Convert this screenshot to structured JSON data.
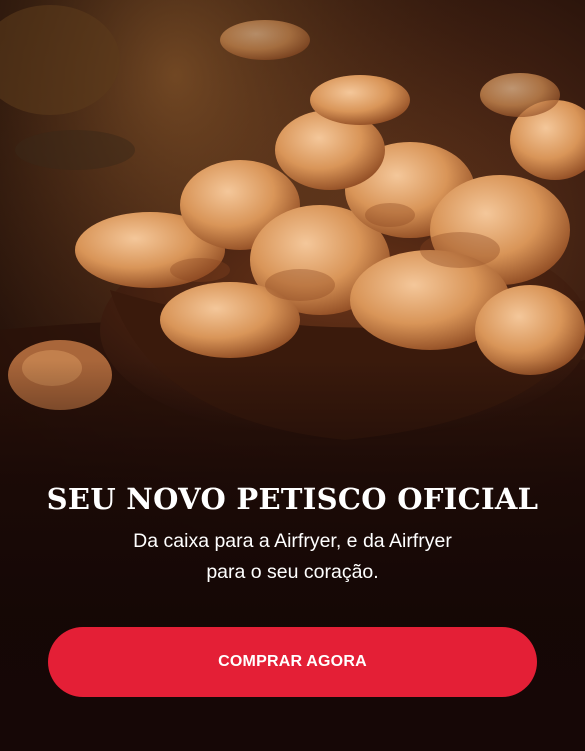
{
  "hero": {
    "headline": "SEU NOVO PETISCO OFICIAL",
    "subtitle_line1": "Da caixa para a Airfryer, e da Airfryer",
    "subtitle_line2": "para o seu coração.",
    "cta_label": "COMPRAR AGORA"
  },
  "colors": {
    "cta_background": "#e41f36",
    "text": "#ffffff",
    "background": "#1a0c08"
  }
}
